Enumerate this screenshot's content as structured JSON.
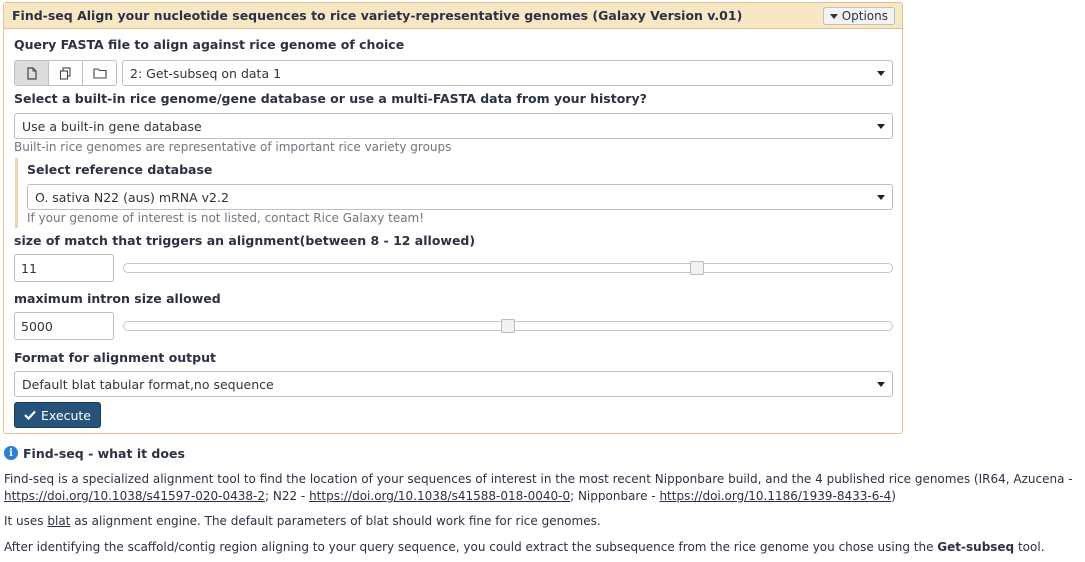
{
  "tool": {
    "title": "Find-seq Align your nucleotide sequences to rice variety-representative genomes (Galaxy Version v.01)",
    "options_label": "Options"
  },
  "query": {
    "label": "Query FASTA file to align against rice genome of choice",
    "selected": "2: Get-subseq on data 1"
  },
  "source": {
    "label": "Select a built-in rice genome/gene database or use a multi-FASTA data from your history?",
    "selected": "Use a built-in gene database",
    "help": "Built-in rice genomes are representative of important rice variety groups"
  },
  "reference": {
    "label": "Select reference database",
    "selected": "O. sativa N22 (aus) mRNA v2.2",
    "help": "If your genome of interest is not listed, contact Rice Galaxy team!"
  },
  "match_size": {
    "label": "size of match that triggers an alignment(between 8 - 12 allowed)",
    "value": "11",
    "slider_fraction": 0.75
  },
  "intron": {
    "label": "maximum intron size allowed",
    "value": "5000",
    "slider_fraction": 0.5
  },
  "format": {
    "label": "Format for alignment output",
    "selected": "Default blat tabular format,no sequence"
  },
  "execute_label": "Execute",
  "help_section": {
    "title": "Find-seq - what it does",
    "p1_line1": "Find-seq is a specialized alignment tool to find the location of your sequences of interest in the most recent Nipponbare build, and the 4 published rice genomes (IR64, Azucena -",
    "link1": "https://doi.org/10.1038/s41597-020-0438-2",
    "sep1": "; N22 - ",
    "link2": "https://doi.org/10.1038/s41588-018-0040-0",
    "sep2": "; Nipponbare - ",
    "link3": "https://doi.org/10.1186/1939-8433-6-4",
    "close": ")",
    "p2_pre": "It uses ",
    "p2_link": "blat",
    "p2_post": " as alignment engine. The default parameters of blat should work fine for rice genomes.",
    "p3_pre": "After identifying the scaffold/contig region aligning to your query sequence, you could extract the subsequence from the rice genome you chose using the ",
    "p3_bold": "Get-subseq",
    "p3_post": " tool."
  }
}
